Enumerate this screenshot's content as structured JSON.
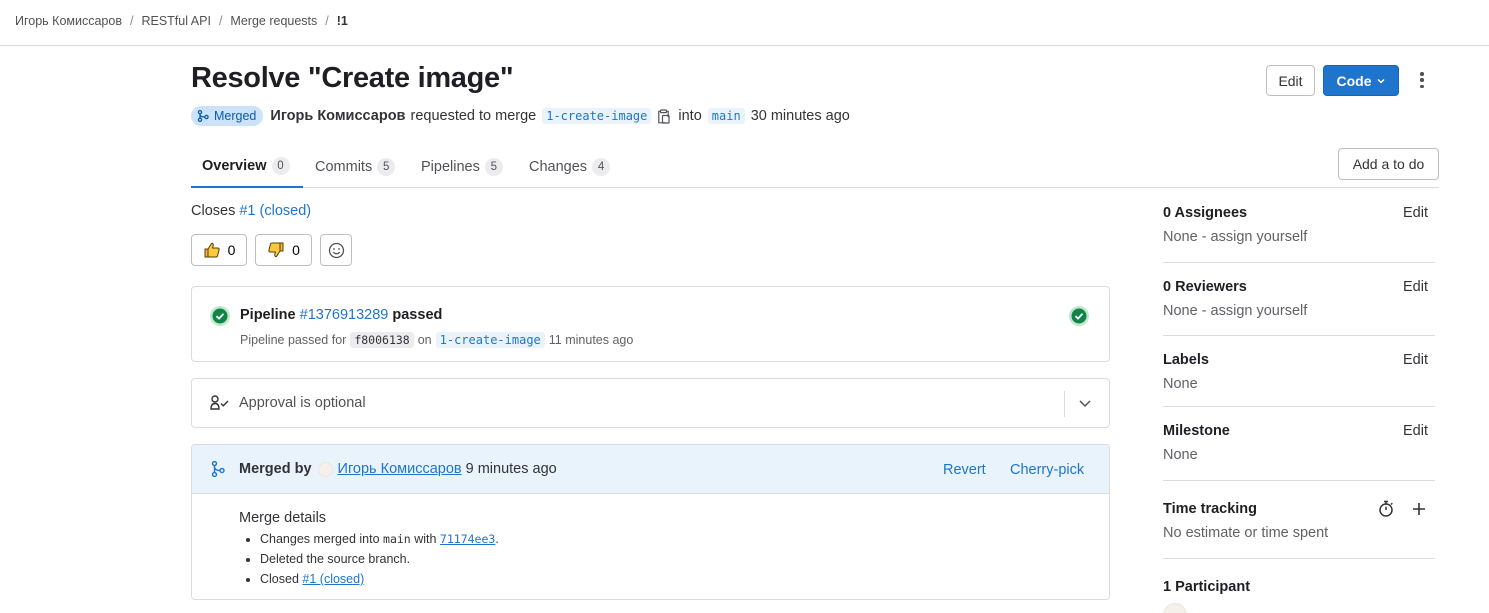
{
  "breadcrumb": [
    "Игорь Комиссаров",
    "RESTful API",
    "Merge requests",
    "!1"
  ],
  "title": "Resolve \"Create image\"",
  "header_buttons": {
    "edit": "Edit",
    "code": "Code"
  },
  "meta": {
    "status": "Merged",
    "author": "Игорь Комиссаров",
    "requested": "requested to merge",
    "source_branch": "1-create-image",
    "into": "into",
    "target_branch": "main",
    "time": "30 minutes ago"
  },
  "tabs": [
    {
      "label": "Overview",
      "count": "0"
    },
    {
      "label": "Commits",
      "count": "5"
    },
    {
      "label": "Pipelines",
      "count": "5"
    },
    {
      "label": "Changes",
      "count": "4"
    }
  ],
  "todo_button": "Add a to do",
  "closes": {
    "prefix": "Closes",
    "link": "#1 (closed)"
  },
  "reactions": {
    "thumbs_up": "0",
    "thumbs_down": "0"
  },
  "pipeline": {
    "title_prefix": "Pipeline",
    "id": "#1376913289",
    "status": "passed",
    "sub_prefix": "Pipeline passed for",
    "sha": "f8006138",
    "on": "on",
    "branch": "1-create-image",
    "time": "11 minutes ago"
  },
  "approval": {
    "text": "Approval is optional"
  },
  "merged": {
    "label": "Merged by",
    "user": "Игорь Комиссаров",
    "time": "9 minutes ago",
    "revert": "Revert",
    "cherry_pick": "Cherry-pick",
    "details_title": "Merge details",
    "line1_prefix": "Changes merged into",
    "line1_branch": "main",
    "line1_with": "with",
    "line1_commit": "71174ee3",
    "line1_end": ".",
    "line2": "Deleted the source branch.",
    "line3_prefix": "Closed",
    "line3_link": "#1 (closed)"
  },
  "sidebar": {
    "assignees": {
      "title": "0 Assignees",
      "value": "None - assign yourself",
      "edit": "Edit"
    },
    "reviewers": {
      "title": "0 Reviewers",
      "value": "None - assign yourself",
      "edit": "Edit"
    },
    "labels": {
      "title": "Labels",
      "value": "None",
      "edit": "Edit"
    },
    "milestone": {
      "title": "Milestone",
      "value": "None",
      "edit": "Edit"
    },
    "time_tracking": {
      "title": "Time tracking",
      "value": "No estimate or time spent"
    },
    "participants": {
      "title": "1 Participant"
    }
  },
  "colors": {
    "accent": "#1f75cb",
    "success": "#108548",
    "merged_badge_bg": "#cbe2f9"
  },
  "icons": [
    "merge-icon",
    "copy-icon",
    "thumbs-up-icon",
    "thumbs-down-icon",
    "smiley-icon",
    "status-success-icon",
    "approval-icon",
    "chevron-down-icon",
    "stopwatch-icon",
    "plus-icon",
    "kebab-icon"
  ]
}
